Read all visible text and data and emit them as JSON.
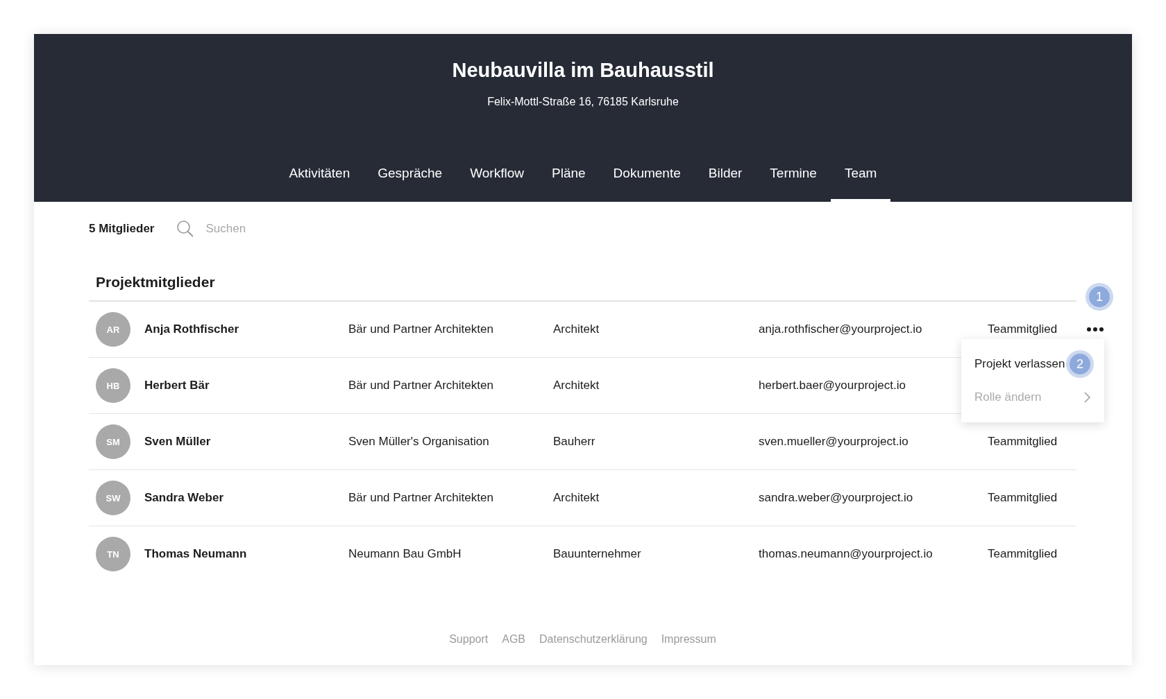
{
  "project": {
    "title": "Neubauvilla im Bauhausstil",
    "address": "Felix-Mottl-Straße 16, 76185 Karlsruhe"
  },
  "tabs": [
    {
      "label": "Aktivitäten",
      "selected": false
    },
    {
      "label": "Gespräche",
      "selected": false
    },
    {
      "label": "Workflow",
      "selected": false
    },
    {
      "label": "Pläne",
      "selected": false
    },
    {
      "label": "Dokumente",
      "selected": false
    },
    {
      "label": "Bilder",
      "selected": false
    },
    {
      "label": "Termine",
      "selected": false
    },
    {
      "label": "Team",
      "selected": true
    }
  ],
  "toolbar": {
    "count": "5 Mitglieder",
    "search": {
      "placeholder": "Suchen"
    }
  },
  "section_title": "Projektmitglieder",
  "members": [
    {
      "initials": "AR",
      "name": "Anja Rothfischer",
      "company": "Bär und Partner Architekten",
      "role": "Architekt",
      "email": "anja.rothfischer@yourproject.io",
      "membership": "Teammitglied",
      "menu_open": true
    },
    {
      "initials": "HB",
      "name": "Herbert Bär",
      "company": "Bär und Partner Architekten",
      "role": "Architekt",
      "email": "herbert.baer@yourproject.io",
      "menu_open": false
    },
    {
      "initials": "SM",
      "name": "Sven Müller",
      "company": "Sven Müller's Organisation",
      "role": "Bauherr",
      "email": "sven.mueller@yourproject.io",
      "membership": "Teammitglied",
      "menu_open": false
    },
    {
      "initials": "SW",
      "name": "Sandra Weber",
      "company": "Bär und Partner Architekten",
      "role": "Architekt",
      "email": "sandra.weber@yourproject.io",
      "membership": "Teammitglied",
      "menu_open": false
    },
    {
      "initials": "TN",
      "name": "Thomas Neumann",
      "company": "Neumann Bau GmbH",
      "role": "Bauunternehmer",
      "email": "thomas.neumann@yourproject.io",
      "membership": "Teammitglied",
      "menu_open": false
    }
  ],
  "step_badge": "1",
  "context_menu": [
    {
      "label": "Projekt verlassen",
      "disabled": false,
      "submenu": false,
      "badge": "2"
    },
    {
      "label": "Rolle ändern",
      "disabled": true,
      "submenu": true
    }
  ],
  "footer_links": [
    "Support",
    "AGB",
    "Datenschutzerklärung",
    "Impressum"
  ]
}
